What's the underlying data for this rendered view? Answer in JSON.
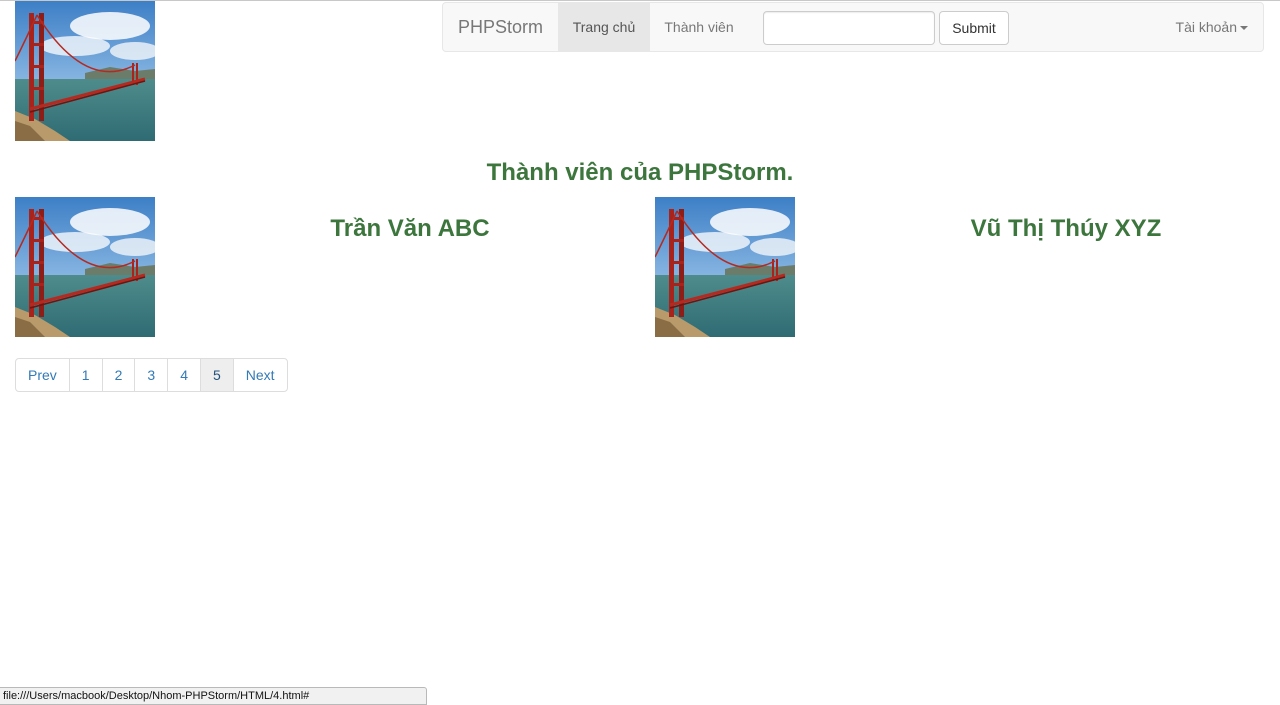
{
  "navbar": {
    "brand": "PHPStorm",
    "items": [
      {
        "label": "Trang chủ",
        "active": true
      },
      {
        "label": "Thành viên",
        "active": false
      }
    ],
    "search": {
      "value": "",
      "placeholder": ""
    },
    "submit_label": "Submit",
    "account_label": "Tài khoản",
    "account_icon": "caret-down-icon"
  },
  "main": {
    "heading": "Thành viên của PHPStorm.",
    "image_icon": "golden-gate-bridge-photo",
    "members": [
      {
        "name": "Trần Văn ABC"
      },
      {
        "name": "Vũ Thị Thúy XYZ"
      }
    ]
  },
  "pagination": {
    "prev_label": "Prev",
    "pages": [
      "1",
      "2",
      "3",
      "4",
      "5"
    ],
    "active_page": "5",
    "next_label": "Next"
  },
  "status_bar": {
    "url": "file:///Users/macbook/Desktop/Nhom-PHPStorm/HTML/4.html#"
  },
  "colors": {
    "heading_green": "#3c763d",
    "link_blue": "#337ab7",
    "navbar_bg": "#f8f8f8"
  }
}
